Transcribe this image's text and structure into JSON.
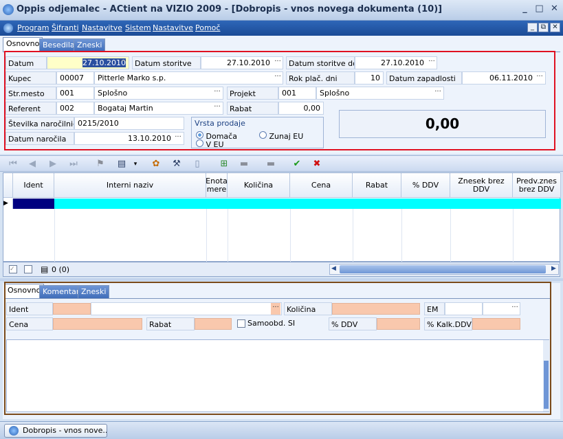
{
  "window": {
    "title": "Oppis odjemalec - ACtient na VIZIO 2009 - [Dobropis - vnos novega dokumenta (10)]",
    "controls": [
      "_",
      "□",
      "✕"
    ]
  },
  "menu": {
    "items": [
      "Program",
      "Šifranti",
      "Nastavitve",
      "Sistem",
      "Nastavitve",
      "Pomoč"
    ],
    "mdi_controls": [
      "_",
      "⧉",
      "✕"
    ]
  },
  "header_tabs": [
    "Osnovno",
    "Besedila",
    "Zneski"
  ],
  "header": {
    "datum_label": "Datum",
    "datum_value": "27.10.2010",
    "datum_storitve_label": "Datum storitve",
    "datum_storitve_value": "27.10.2010",
    "datum_storitve_do_label": "Datum storitve do",
    "datum_storitve_do_value": "27.10.2010",
    "kupec_label": "Kupec",
    "kupec_code": "00007",
    "kupec_name": "Pitterle Marko s.p.",
    "rok_label": "Rok plač. dni",
    "rok_value": "10",
    "datum_zapadlosti_label": "Datum zapadlosti",
    "datum_zapadlosti_value": "06.11.2010",
    "strmesto_label": "Str.mesto",
    "strmesto_code": "001",
    "strmesto_name": "Splošno",
    "projekt_label": "Projekt",
    "projekt_code": "001",
    "projekt_name": "Splošno",
    "referent_label": "Referent",
    "referent_code": "002",
    "referent_name": "Bogataj Martin",
    "rabat_label": "Rabat",
    "rabat_value": "0,00",
    "narocilnica_label": "Številka naročilnice",
    "narocilnica_value": "0215/2010",
    "datum_narocila_label": "Datum naročila",
    "datum_narocila_value": "13.10.2010",
    "vrsta_prodaje_label": "Vrsta prodaje",
    "vrsta_options": [
      "Domača",
      "Zunaj EU",
      "V EU"
    ],
    "vrsta_selected": "Domača",
    "total": "0,00",
    "dots": "···"
  },
  "grid": {
    "columns": [
      "Ident",
      "Interni naziv",
      "Enota mere",
      "Količina",
      "Cena",
      "Rabat",
      "% DDV",
      "Znesek brez DDV",
      "Predv.znes brez DDV"
    ],
    "footer_count": "0 (0)"
  },
  "detail_tabs": [
    "Osnovno",
    "Komentar",
    "Zneski"
  ],
  "detail": {
    "ident_label": "Ident",
    "kolicina_label": "Količina",
    "em_label": "EM",
    "cena_label": "Cena",
    "rabat_label": "Rabat",
    "samoobd_label": "Samoobd. SI",
    "ddv_label": "% DDV",
    "kalk_ddv_label": "% Kalk.DDV"
  },
  "statusbar": {
    "task_label": "Dobropis - vnos nove..."
  },
  "colors": {
    "accent": "#1b4b96",
    "selection": "#00ffff",
    "red_frame": "#e01020",
    "brown_frame": "#7a4a1a"
  }
}
